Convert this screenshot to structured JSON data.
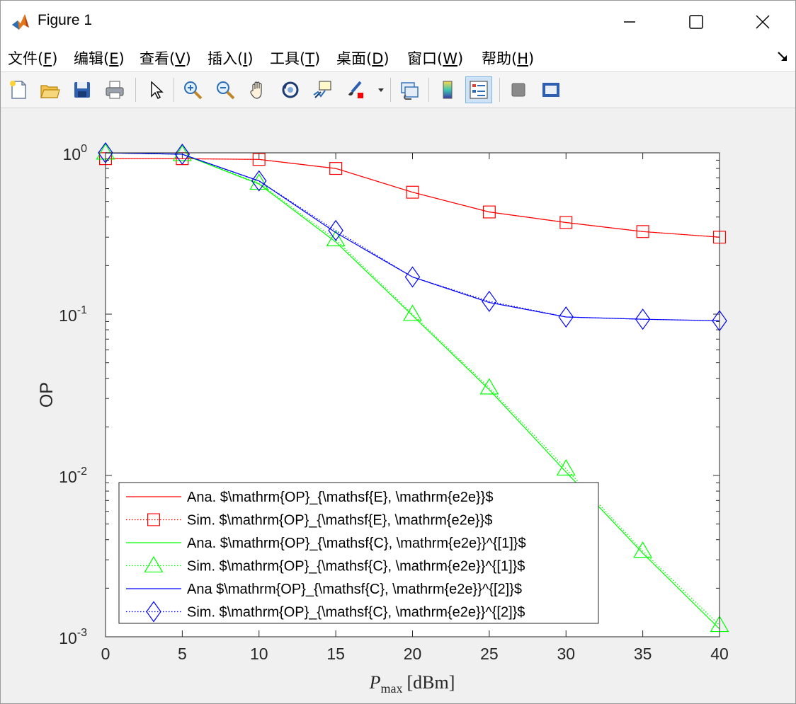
{
  "window": {
    "title": "Figure 1",
    "controls": {
      "minimize": "minimize",
      "maximize": "maximize",
      "close": "close"
    }
  },
  "menu": {
    "items": [
      {
        "label": "文件",
        "accel": "F"
      },
      {
        "label": "编辑",
        "accel": "E"
      },
      {
        "label": "查看",
        "accel": "V"
      },
      {
        "label": "插入",
        "accel": "I"
      },
      {
        "label": "工具",
        "accel": "T"
      },
      {
        "label": "桌面",
        "accel": "D"
      },
      {
        "label": "窗口",
        "accel": "W"
      },
      {
        "label": "帮助",
        "accel": "H"
      }
    ]
  },
  "toolbar": {
    "buttons": [
      {
        "name": "new-figure-icon",
        "active": false
      },
      {
        "name": "open-file-icon",
        "active": false
      },
      {
        "name": "save-icon",
        "active": false
      },
      {
        "name": "print-icon",
        "active": false
      },
      {
        "name": "edit-plot-arrow-icon",
        "active": false
      },
      {
        "name": "zoom-in-icon",
        "active": false
      },
      {
        "name": "zoom-out-icon",
        "active": false
      },
      {
        "name": "pan-hand-icon",
        "active": false
      },
      {
        "name": "rotate-3d-icon",
        "active": false
      },
      {
        "name": "data-cursor-icon",
        "active": false
      },
      {
        "name": "brush-icon",
        "active": false
      },
      {
        "name": "brush-dropdown-icon",
        "active": false
      },
      {
        "name": "link-plot-icon",
        "active": false
      },
      {
        "name": "insert-colorbar-icon",
        "active": false
      },
      {
        "name": "insert-legend-icon",
        "active": true
      },
      {
        "name": "hide-plot-tools-icon",
        "active": false
      },
      {
        "name": "show-plot-tools-icon",
        "active": false
      }
    ]
  },
  "chart_data": {
    "type": "line",
    "xlabel": "P_max [dBm]",
    "xlabel_main": "P",
    "xlabel_sub": "max",
    "xlabel_unit": "[dBm]",
    "ylabel": "OP",
    "xlim": [
      0,
      40
    ],
    "ylim": [
      0.001,
      1
    ],
    "yscale": "log",
    "xticks": [
      0,
      5,
      10,
      15,
      20,
      25,
      30,
      35,
      40
    ],
    "yticks": [
      {
        "value": 1,
        "base": "10",
        "exp": "0"
      },
      {
        "value": 0.1,
        "base": "10",
        "exp": "-1"
      },
      {
        "value": 0.01,
        "base": "10",
        "exp": "-2"
      },
      {
        "value": 0.001,
        "base": "10",
        "exp": "-3"
      }
    ],
    "x": [
      0,
      5,
      10,
      15,
      20,
      25,
      30,
      35,
      40
    ],
    "legend_position": "bottom-left",
    "series": [
      {
        "name": "Ana. $\\mathrm{OP}_{\\mathsf{E}, \\mathrm{e2e}}$",
        "color": "#ff0000",
        "linestyle": "solid",
        "marker": "none",
        "values": [
          0.92,
          0.92,
          0.91,
          0.8,
          0.57,
          0.43,
          0.37,
          0.325,
          0.3
        ]
      },
      {
        "name": "Sim. $\\mathrm{OP}_{\\mathsf{E}, \\mathrm{e2e}}$",
        "color": "#ff0000",
        "linestyle": "dotted",
        "marker": "square",
        "values": [
          0.92,
          0.92,
          0.91,
          0.8,
          0.57,
          0.43,
          0.37,
          0.325,
          0.3
        ]
      },
      {
        "name": "Ana. $\\mathrm{OP}_{\\mathsf{C}, \\mathrm{e2e}}^{[1]}$",
        "color": "#00ff00",
        "linestyle": "solid",
        "marker": "none",
        "values": [
          1.0,
          0.98,
          0.64,
          0.28,
          0.098,
          0.034,
          0.0105,
          0.0033,
          0.00112
        ]
      },
      {
        "name": "Sim. $\\mathrm{OP}_{\\mathsf{C}, \\mathrm{e2e}}^{[1]}$",
        "color": "#00ff00",
        "linestyle": "dotted",
        "marker": "triangle",
        "values": [
          1.0,
          0.98,
          0.65,
          0.29,
          0.1,
          0.035,
          0.011,
          0.0034,
          0.00118
        ]
      },
      {
        "name": "Ana $\\mathrm{OP}_{\\mathsf{C}, \\mathrm{e2e}}^{[2]}$",
        "color": "#0000ff",
        "linestyle": "solid",
        "marker": "none",
        "values": [
          1.0,
          0.98,
          0.67,
          0.32,
          0.17,
          0.118,
          0.096,
          0.093,
          0.091
        ]
      },
      {
        "name": "Sim. $\\mathrm{OP}_{\\mathsf{C}, \\mathrm{e2e}}^{[2]}$",
        "color": "#0000ff",
        "linestyle": "dotted",
        "marker": "diamond",
        "values": [
          1.0,
          0.98,
          0.67,
          0.33,
          0.17,
          0.12,
          0.096,
          0.093,
          0.091
        ]
      }
    ]
  }
}
